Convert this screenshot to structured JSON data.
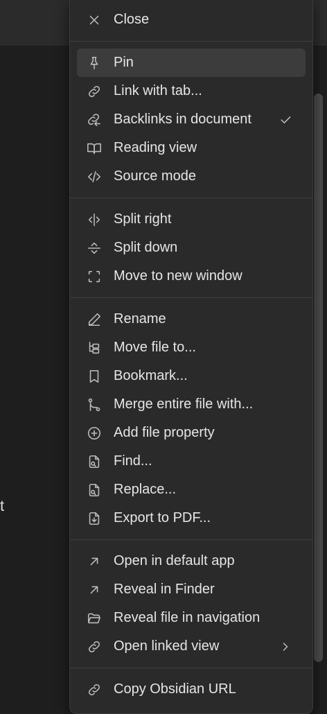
{
  "background": {
    "text_fragment": "t"
  },
  "menu": {
    "sections": [
      [
        {
          "label": "Close",
          "icon": "close-icon"
        }
      ],
      [
        {
          "label": "Pin",
          "icon": "pin-icon",
          "active": true
        },
        {
          "label": "Link with tab...",
          "icon": "link-icon"
        },
        {
          "label": "Backlinks in document",
          "icon": "backlinks-icon",
          "checked": true
        },
        {
          "label": "Reading view",
          "icon": "book-open-icon"
        },
        {
          "label": "Source mode",
          "icon": "code-icon"
        }
      ],
      [
        {
          "label": "Split right",
          "icon": "split-right-icon"
        },
        {
          "label": "Split down",
          "icon": "split-down-icon"
        },
        {
          "label": "Move to new window",
          "icon": "new-window-icon"
        }
      ],
      [
        {
          "label": "Rename",
          "icon": "pencil-icon"
        },
        {
          "label": "Move file to...",
          "icon": "folder-tree-icon"
        },
        {
          "label": "Bookmark...",
          "icon": "bookmark-icon"
        },
        {
          "label": "Merge entire file with...",
          "icon": "merge-icon"
        },
        {
          "label": "Add file property",
          "icon": "plus-circle-icon"
        },
        {
          "label": "Find...",
          "icon": "file-search-icon"
        },
        {
          "label": "Replace...",
          "icon": "file-replace-icon"
        },
        {
          "label": "Export to PDF...",
          "icon": "file-export-icon"
        }
      ],
      [
        {
          "label": "Open in default app",
          "icon": "arrow-up-right-icon"
        },
        {
          "label": "Reveal in Finder",
          "icon": "arrow-up-right-icon"
        },
        {
          "label": "Reveal file in navigation",
          "icon": "folder-open-icon"
        },
        {
          "label": "Open linked view",
          "icon": "link-icon",
          "submenu": true
        }
      ],
      [
        {
          "label": "Copy Obsidian URL",
          "icon": "link-icon"
        }
      ]
    ]
  }
}
